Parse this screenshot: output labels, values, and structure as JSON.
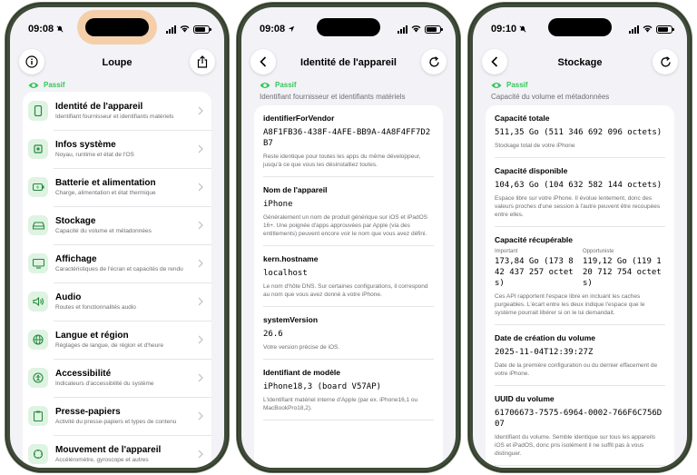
{
  "phones": [
    {
      "time": "09:08",
      "title": "Loupe",
      "mode": "Passif",
      "items": [
        {
          "title": "Identité de l'appareil",
          "desc": "Identifiant fournisseur et identifiants matériels"
        },
        {
          "title": "Infos système",
          "desc": "Noyau, runtime et état de l'OS"
        },
        {
          "title": "Batterie et alimentation",
          "desc": "Charge, alimentation et état thermique"
        },
        {
          "title": "Stockage",
          "desc": "Capacité du volume et métadonnées"
        },
        {
          "title": "Affichage",
          "desc": "Caractéristiques de l'écran et capacités de rendu"
        },
        {
          "title": "Audio",
          "desc": "Routes et fonctionnalités audio"
        },
        {
          "title": "Langue et région",
          "desc": "Réglages de langue, de région et d'heure"
        },
        {
          "title": "Accessibilité",
          "desc": "Indicateurs d'accessibilité du système"
        },
        {
          "title": "Presse-papiers",
          "desc": "Activité du presse-papiers et types de contenu"
        },
        {
          "title": "Mouvement de l'appareil",
          "desc": "Accéléromètre, gyroscope et autres"
        }
      ]
    },
    {
      "time": "09:08",
      "title": "Identité de l'appareil",
      "mode": "Passif",
      "subtitle": "Identifiant fournisseur et identifiants matériels",
      "sections": [
        {
          "label": "identifierForVendor",
          "value": "A8F1FB36-438F-4AFE-BB9A-4A8F4FF7D2B7",
          "desc": "Reste identique pour toutes les apps du même développeur, jusqu'à ce que vous les désinstalliez toutes."
        },
        {
          "label": "Nom de l'appareil",
          "value": "iPhone",
          "desc": "Généralement un nom de produit générique sur iOS et iPadOS 16+. Une poignée d'apps approuvées par Apple (via des entitlements) peuvent encore voir le nom que vous avez défini."
        },
        {
          "label": "kern.hostname",
          "value": "localhost",
          "desc": "Le nom d'hôte DNS. Sur certaines configurations, il correspond au nom que vous avez donné à votre iPhone."
        },
        {
          "label": "systemVersion",
          "value": "26.6",
          "desc": "Votre version précise de iOS."
        },
        {
          "label": "Identifiant de modèle",
          "value": "iPhone18,3 (board V57AP)",
          "desc": "L'identifiant matériel interne d'Apple (par ex. iPhone16,1 ou MacBookPro18,2)."
        }
      ]
    },
    {
      "time": "09:10",
      "title": "Stockage",
      "mode": "Passif",
      "subtitle": "Capacité du volume et métadonnées",
      "sections": [
        {
          "label": "Capacité totale",
          "value": "511,35 Go (511 346 692 096 octets)",
          "desc": "Stockage total de votre iPhone"
        },
        {
          "label": "Capacité disponible",
          "value": "104,63 Go (104 632 582 144 octets)",
          "desc": "Espace libre sur votre iPhone. Il évolue lentement, donc des valeurs proches d'une session à l'autre peuvent être recoupées entre elles."
        },
        {
          "label": "Date de création du volume",
          "value": "2025-11-04T12:39:27Z",
          "desc": "Date de la première configuration ou du dernier effacement de votre iPhone."
        },
        {
          "label": "UUID du volume",
          "value": "61706673-7575-6964-0002-766F6C756D07",
          "desc": "Identifiant du volume. Semble identique sur tous les appareils iOS et iPadOS, donc pris isolément il ne suffit pas à vous distinguer."
        }
      ],
      "recoverable": {
        "label": "Capacité récupérable",
        "important_label": "Important",
        "important_value": "173,84 Go (173 842 437 257 octets)",
        "opportunistic_label": "Opportuniste",
        "opportunistic_value": "119,12 Go (119 120 712 754 octets)",
        "desc": "Ces API rapportent l'espace libre en incluant les caches purgeables. L'écart entre les deux indique l'espace que le système pourrait libérer si on le lui demandait."
      }
    }
  ],
  "colors": {
    "accent": "#34c759",
    "icon_bg": "#dff3e2",
    "frame": "#3f4a39"
  },
  "icons": [
    "info-icon",
    "share-icon",
    "back-chevron-icon",
    "reload-icon",
    "eye-icon",
    "chevron-right-icon"
  ]
}
